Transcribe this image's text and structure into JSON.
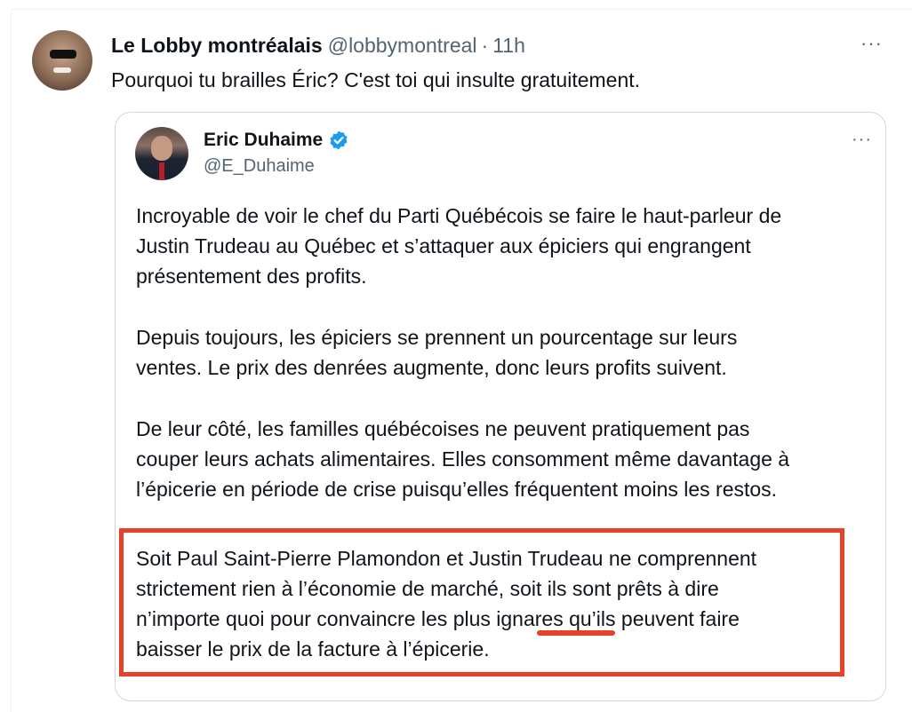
{
  "tweet": {
    "author_name": "Le Lobby montréalais",
    "author_handle": "@lobbymontreal",
    "separator": "·",
    "timestamp": "11h",
    "more": "···",
    "text": "Pourquoi tu brailles Éric? C'est toi qui insulte gratuitement."
  },
  "quoted": {
    "author_name": "Eric Duhaime",
    "author_handle": "@E_Duhaime",
    "verified": true,
    "more": "···",
    "paragraphs": [
      {
        "lines": [
          "Incroyable de voir le chef du Parti Québécois se faire le haut-parleur de",
          "Justin Trudeau au Québec et s’attaquer aux épiciers qui engrangent",
          "présentement des profits."
        ]
      },
      {
        "lines": [
          "Depuis toujours, les épiciers se prennent un pourcentage sur leurs",
          "ventes. Le prix des denrées augmente, donc leurs profits suivent."
        ]
      },
      {
        "lines": [
          "De leur côté, les familles québécoises ne peuvent pratiquement pas",
          "couper leurs achats alimentaires. Elles consomment même davantage à",
          "l’épicerie en période de crise puisqu’elles fréquentent moins les restos."
        ]
      }
    ],
    "highlighted": {
      "lines": [
        "Soit Paul Saint-Pierre Plamondon et Justin Trudeau ne comprennent",
        "strictement rien à l’économie de marché, soit ils sont prêts à dire",
        "n’importe quoi pour convaincre les plus ignares qu’ils peuvent faire",
        "baisser le prix de la facture à l’épicerie."
      ],
      "underlined_word": "ignares"
    }
  },
  "colors": {
    "highlight": "#e8412a",
    "verified": "#1d9bf0",
    "secondary_text": "#536471"
  }
}
